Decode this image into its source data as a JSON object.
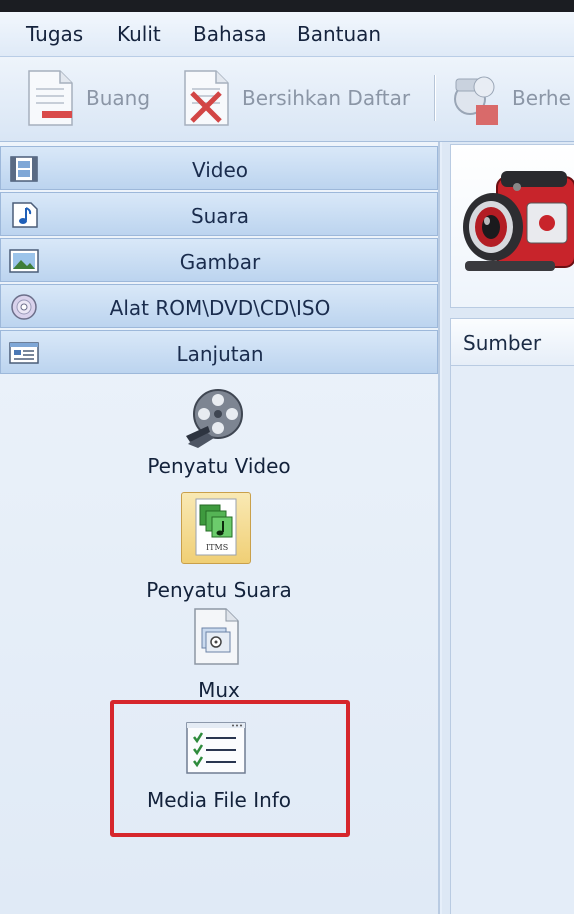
{
  "menu": {
    "items": [
      {
        "label": "Tugas"
      },
      {
        "label": "Kulit"
      },
      {
        "label": "Bahasa"
      },
      {
        "label": "Bantuan"
      }
    ]
  },
  "toolbar": {
    "remove_label": "Buang",
    "clear_list_label": "Bersihkan Daftar",
    "stop_label": "Berhe"
  },
  "sidebar": {
    "categories": [
      {
        "label": "Video",
        "icon": "film-strip-icon"
      },
      {
        "label": "Suara",
        "icon": "music-note-icon"
      },
      {
        "label": "Gambar",
        "icon": "picture-icon"
      },
      {
        "label": "Alat ROM\\DVD\\CD\\ISO",
        "icon": "disc-icon"
      },
      {
        "label": "Lanjutan",
        "icon": "advanced-window-icon"
      }
    ],
    "tools": [
      {
        "label": "Penyatu Video",
        "icon": "film-reel-icon"
      },
      {
        "label": "Penyatu Suara",
        "icon": "audio-join-icon",
        "icon_text": "ITMS"
      },
      {
        "label": "Mux",
        "icon": "mux-file-icon"
      },
      {
        "label": "Media File Info",
        "icon": "checklist-icon"
      }
    ],
    "highlight_color": "#d6262c"
  },
  "rightpane": {
    "source_header": "Sumber"
  }
}
